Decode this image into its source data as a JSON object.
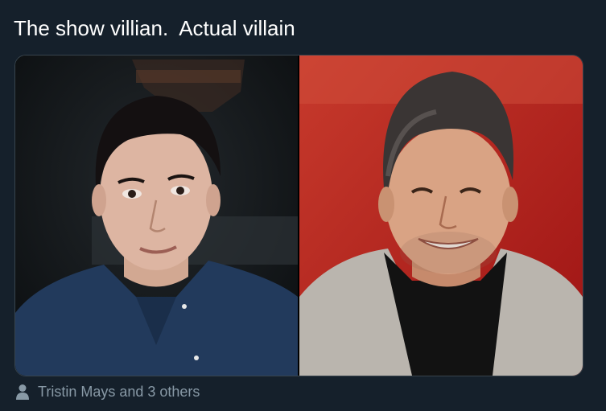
{
  "tweet": {
    "text": "The show villian.  Actual villain"
  },
  "media": {
    "photos": [
      {
        "name": "left-photo",
        "background": "#121619",
        "accent": "#1d3557"
      },
      {
        "name": "right-photo",
        "background": "#b12020",
        "accent": "#bdb8b2"
      }
    ]
  },
  "tagged": {
    "icon": "person-icon",
    "text": "Tristin Mays and 3 others"
  },
  "colors": {
    "background": "#15202b",
    "text": "#ffffff",
    "muted": "#8899a6",
    "border": "#38444d"
  }
}
